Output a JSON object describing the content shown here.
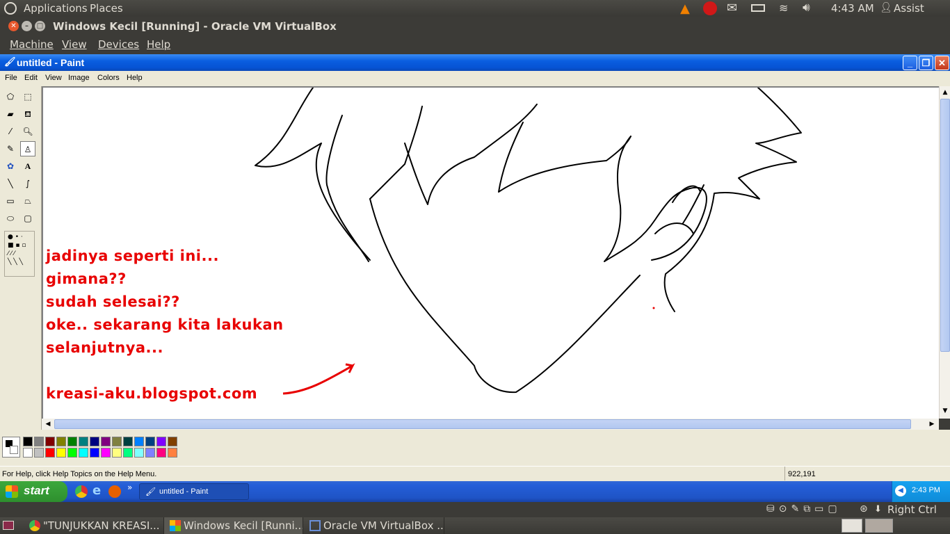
{
  "ubuntu_panel": {
    "applications": "Applications",
    "places": "Places",
    "clock": "4:43 AM",
    "user": "Assist"
  },
  "vbox_window": {
    "title": "Windows Kecil [Running] - Oracle VM VirtualBox",
    "menu": [
      "Machine",
      "View",
      "Devices",
      "Help"
    ],
    "host_key": "Right Ctrl"
  },
  "paint": {
    "title": "untitled - Paint",
    "menu": [
      "File",
      "Edit",
      "View",
      "Image",
      "Colors",
      "Help"
    ],
    "status_help": "For Help, click Help Topics on the Help Menu.",
    "coords": "922,191",
    "canvas_text": [
      "jadinya seperti ini...",
      "gimana??",
      "sudah selesai??",
      "oke.. sekarang kita lakukan",
      "selanjutnya...",
      "kreasi-aku.blogspot.com"
    ],
    "palette_top": [
      "#000000",
      "#808080",
      "#800000",
      "#808000",
      "#008000",
      "#008080",
      "#000080",
      "#800080",
      "#808040",
      "#004040",
      "#0080ff",
      "#004080",
      "#8000ff",
      "#804000"
    ],
    "palette_bottom": [
      "#ffffff",
      "#c0c0c0",
      "#ff0000",
      "#ffff00",
      "#00ff00",
      "#00ffff",
      "#0000ff",
      "#ff00ff",
      "#ffff80",
      "#00ff80",
      "#80ffff",
      "#8080ff",
      "#ff0080",
      "#ff8040"
    ]
  },
  "xp_taskbar": {
    "start": "start",
    "task": "untitled - Paint",
    "clock": "2:43 PM"
  },
  "ubuntu_taskbar": {
    "tasks": [
      "\"TUNJUKKAN KREASI...",
      "Windows Kecil [Runni...",
      "Oracle VM VirtualBox ..."
    ]
  }
}
